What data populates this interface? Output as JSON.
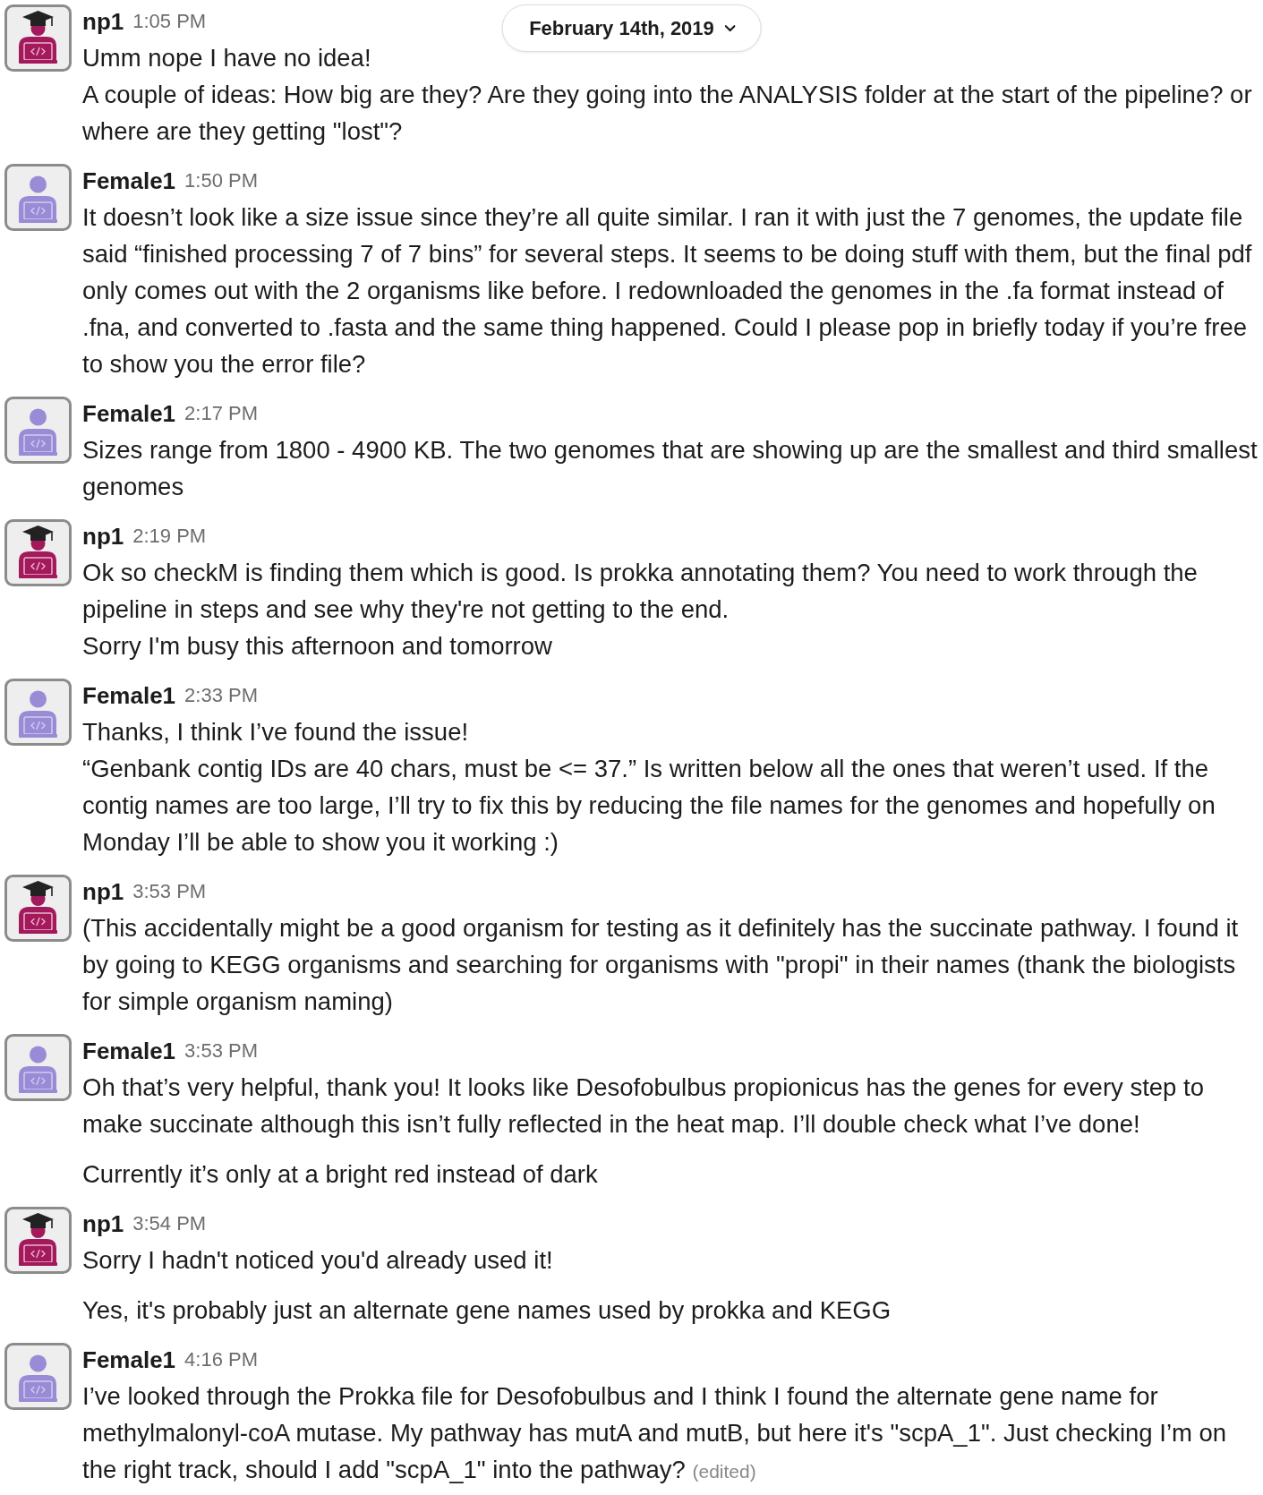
{
  "date_divider": {
    "label": "February 14th, 2019"
  },
  "messages": [
    {
      "author": "np1",
      "kind": "graduate",
      "time": "1:05 PM",
      "posts": [
        {
          "lines": [
            "Umm nope I have no idea!",
            "A couple of ideas: How big are they? Are they going into the ANALYSIS folder at the start of the pipeline? or where are they getting \"lost\"?"
          ]
        }
      ]
    },
    {
      "author": "Female1",
      "kind": "person",
      "time": "1:50 PM",
      "posts": [
        {
          "lines": [
            "It doesn’t look like a size issue since they’re all quite similar. I ran it with just the 7 genomes, the update file said “finished processing 7 of 7 bins” for several steps. It seems to be doing stuff with them, but the final pdf only comes out with the 2 organisms like before. I redownloaded the genomes in the .fa format instead of .fna, and converted to .fasta and the same thing happened. Could I please pop in briefly today if you’re free to show you the error file?"
          ]
        }
      ]
    },
    {
      "author": "Female1",
      "kind": "person",
      "time": "2:17 PM",
      "posts": [
        {
          "lines": [
            "Sizes range from 1800 - 4900 KB. The two genomes that are showing up are the smallest and third smallest genomes"
          ]
        }
      ]
    },
    {
      "author": "np1",
      "kind": "graduate",
      "time": "2:19 PM",
      "posts": [
        {
          "lines": [
            "Ok so checkM is finding them which is good. Is prokka annotating them? You need to work through the pipeline in steps and see why they're not getting to the end.",
            "Sorry I'm busy this afternoon and tomorrow"
          ]
        }
      ]
    },
    {
      "author": "Female1",
      "kind": "person",
      "time": "2:33 PM",
      "posts": [
        {
          "lines": [
            "Thanks, I think I’ve found the issue!",
            "“Genbank contig IDs are 40 chars, must be <= 37.” Is written below all the ones that weren’t used. If the contig names are too large, I’ll try to fix this by reducing the file names for the genomes and hopefully on Monday I’ll be able to show you it working :)"
          ]
        }
      ]
    },
    {
      "author": "np1",
      "kind": "graduate",
      "time": "3:53 PM",
      "posts": [
        {
          "lines": [
            "(This accidentally might be a good organism for testing as it definitely has the succinate pathway. I found it by going to KEGG organisms and searching for organisms with \"propi\" in their names (thank the biologists for simple organism naming)"
          ]
        }
      ]
    },
    {
      "author": "Female1",
      "kind": "person",
      "time": "3:53 PM",
      "posts": [
        {
          "lines": [
            "Oh that’s very helpful, thank you! It looks like Desofobulbus propionicus has the genes for every step to make succinate although this isn’t fully reflected in the heat map. I’ll double check what I’ve done!"
          ]
        },
        {
          "lines": [
            "Currently it’s only at a bright red instead of dark"
          ]
        }
      ]
    },
    {
      "author": "np1",
      "kind": "graduate",
      "time": "3:54 PM",
      "posts": [
        {
          "lines": [
            "Sorry I hadn't noticed you'd already used it!"
          ]
        },
        {
          "lines": [
            "Yes, it's probably just an alternate gene names used by prokka and KEGG"
          ]
        }
      ]
    },
    {
      "author": "Female1",
      "kind": "person",
      "time": "4:16 PM",
      "posts": [
        {
          "lines": [
            "I’ve looked through the Prokka file for Desofobulbus and I think I found the alternate gene name for methylmalonyl-coA mutase. My pathway has mutA and mutB, but here it's \"scpA_1\". Just checking I’m on the right track, should I add \"scpA_1\" into the pathway?"
          ],
          "edited": "(edited)"
        }
      ]
    }
  ]
}
